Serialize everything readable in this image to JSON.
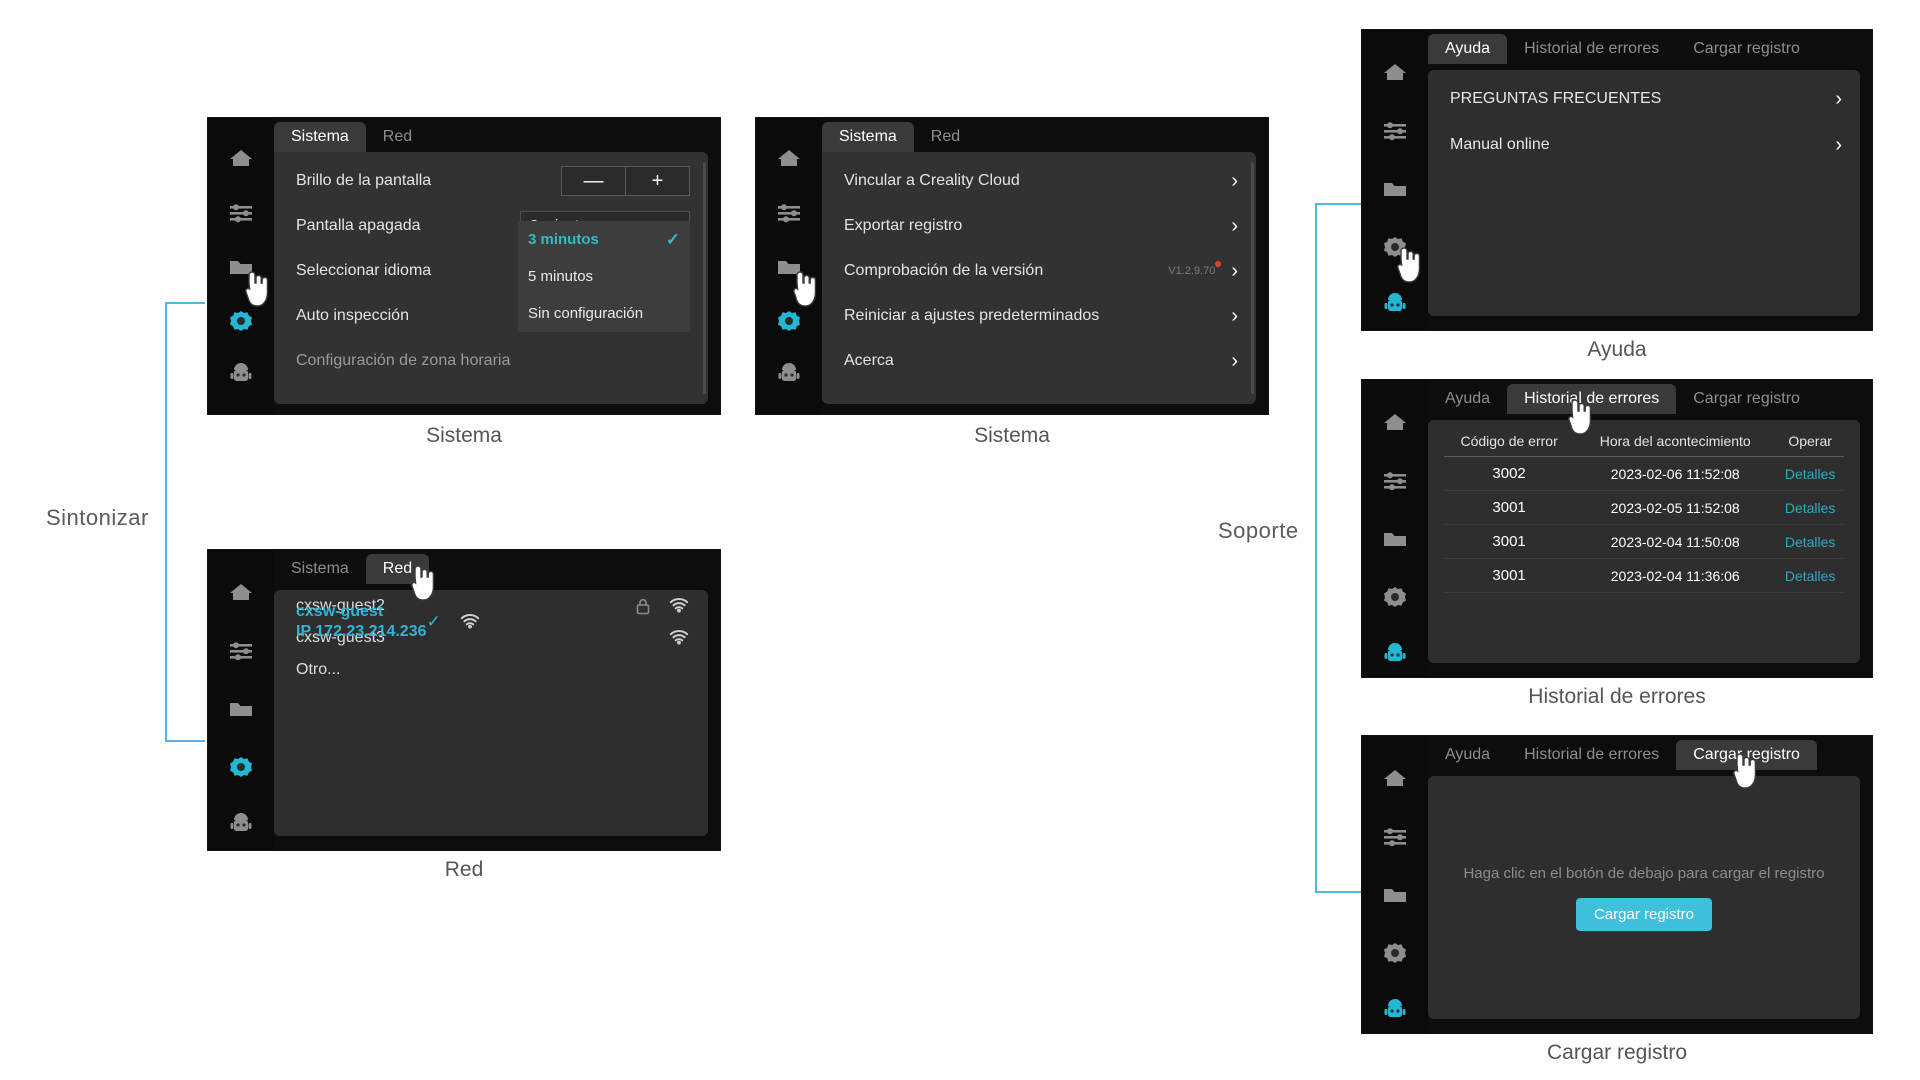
{
  "groups": [
    {
      "label": "Sintonizar"
    },
    {
      "label": "Soporte"
    }
  ],
  "captions": {
    "system_dropdown": "Sistema",
    "system_menu": "Sistema",
    "network": "Red",
    "help": "Ayuda",
    "error_history": "Historial de errores",
    "upload_log": "Cargar registro"
  },
  "rail": {
    "icons": [
      "home-icon",
      "tune-icon",
      "folder-icon",
      "gear-icon",
      "robot-icon"
    ]
  },
  "panel_system_settings": {
    "tabs": [
      {
        "label": "Sistema",
        "active": true
      },
      {
        "label": "Red",
        "active": false
      }
    ],
    "rows": [
      {
        "label": "Brillo de la pantalla",
        "control": "stepper",
        "minus": "—",
        "plus": "+"
      },
      {
        "label": "Pantalla apagada",
        "control": "dropdown",
        "value": "3 minutos"
      },
      {
        "label": "Seleccionar idioma",
        "control": "none"
      },
      {
        "label": "Auto inspección",
        "control": "none"
      },
      {
        "label": "Configuración de zona horaria",
        "control": "none"
      }
    ],
    "dropdown_options": [
      {
        "label": "3 minutos",
        "selected": true
      },
      {
        "label": "5 minutos",
        "selected": false
      },
      {
        "label": "Sin configuración",
        "selected": false
      }
    ]
  },
  "panel_system_menu": {
    "tabs": [
      {
        "label": "Sistema",
        "active": true
      },
      {
        "label": "Red",
        "active": false
      }
    ],
    "items": [
      {
        "label": "Vincular a Creality Cloud",
        "meta": ""
      },
      {
        "label": "Exportar registro",
        "meta": ""
      },
      {
        "label": "Comprobación de la versión",
        "meta": "V1.2.9.70",
        "badge": true
      },
      {
        "label": "Reiniciar a ajustes predeterminados",
        "meta": ""
      },
      {
        "label": "Acerca",
        "meta": ""
      }
    ]
  },
  "panel_network": {
    "tabs": [
      {
        "label": "Sistema",
        "active": false
      },
      {
        "label": "Red",
        "active": true
      }
    ],
    "networks": [
      {
        "ssid": "cxsw-guest",
        "ip": "IP  172.23.214.236",
        "connected": true,
        "locked": false,
        "wifi": true
      },
      {
        "ssid": "cxsw-guest2",
        "ip": "",
        "connected": false,
        "locked": true,
        "wifi": true
      },
      {
        "ssid": "cxsw-guest3",
        "ip": "",
        "connected": false,
        "locked": false,
        "wifi": true
      },
      {
        "ssid": "Otro...",
        "ip": "",
        "connected": false,
        "locked": false,
        "wifi": false
      }
    ]
  },
  "panel_help": {
    "tabs": [
      {
        "label": "Ayuda",
        "active": true
      },
      {
        "label": "Historial de errores",
        "active": false
      },
      {
        "label": "Cargar registro",
        "active": false
      }
    ],
    "items": [
      {
        "label": "PREGUNTAS FRECUENTES"
      },
      {
        "label": "Manual online"
      }
    ]
  },
  "panel_errors": {
    "tabs": [
      {
        "label": "Ayuda",
        "active": false
      },
      {
        "label": "Historial de errores",
        "active": true
      },
      {
        "label": "Cargar registro",
        "active": false
      }
    ],
    "columns": [
      "Código de error",
      "Hora del acontecimiento",
      "Operar"
    ],
    "rows": [
      {
        "code": "3002",
        "time": "2023-02-06  11:52:08",
        "action": "Detalles"
      },
      {
        "code": "3001",
        "time": "2023-02-05  11:52:08",
        "action": "Detalles"
      },
      {
        "code": "3001",
        "time": "2023-02-04  11:50:08",
        "action": "Detalles"
      },
      {
        "code": "3001",
        "time": "2023-02-04  11:36:06",
        "action": "Detalles"
      }
    ]
  },
  "panel_upload": {
    "tabs": [
      {
        "label": "Ayuda",
        "active": false
      },
      {
        "label": "Historial de errores",
        "active": false
      },
      {
        "label": "Cargar registro",
        "active": true
      }
    ],
    "hint": "Haga clic en el botón de debajo para cargar el registro",
    "button": "Cargar registro"
  },
  "colors": {
    "accent": "#3fc0dd",
    "accent_text": "#30bcc4",
    "connector": "#4fb8e0",
    "badge": "#e8402a",
    "panel_bg": "#323232",
    "screen_bg": "#0d0d0d"
  }
}
